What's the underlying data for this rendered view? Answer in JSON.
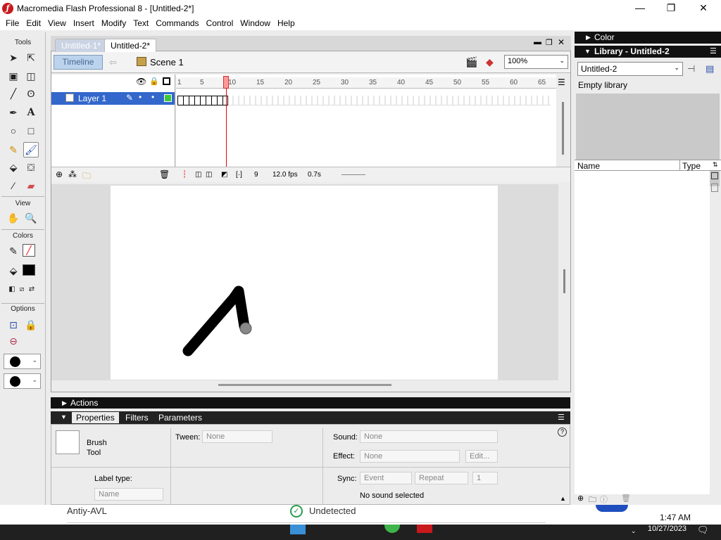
{
  "window": {
    "title": "Macromedia Flash Professional 8 - [Untitled-2*]",
    "minimize_glyph": "—",
    "maximize_glyph": "❐",
    "close_glyph": "✕"
  },
  "menu": [
    "File",
    "Edit",
    "View",
    "Insert",
    "Modify",
    "Text",
    "Commands",
    "Control",
    "Window",
    "Help"
  ],
  "tools": {
    "header": "Tools",
    "view_header": "View",
    "colors_header": "Colors",
    "options_header": "Options",
    "selected_tool": "brush-tool"
  },
  "document": {
    "tabs": [
      "Untitled-1*",
      "Untitled-2*"
    ],
    "active_tab": "Untitled-2*",
    "timeline_button": "Timeline",
    "scene": "Scene 1",
    "zoom": "100%"
  },
  "timeline": {
    "layer_name": "Layer 1",
    "ruler_ticks": [
      "1",
      "5",
      "10",
      "15",
      "20",
      "25",
      "30",
      "35",
      "40",
      "45",
      "50",
      "55",
      "60",
      "65"
    ],
    "current_frame": "9",
    "frame_rate": "12.0 fps",
    "elapsed": "0.7s"
  },
  "panels": {
    "actions": "Actions",
    "property_tabs": [
      "Properties",
      "Filters",
      "Parameters"
    ],
    "tool_name_line1": "Brush",
    "tool_name_line2": "Tool",
    "tween_label": "Tween:",
    "tween_value": "None",
    "sound_label": "Sound:",
    "sound_value": "None",
    "effect_label": "Effect:",
    "effect_value": "None",
    "edit_button": "Edit...",
    "label_type_label": "Label type:",
    "label_type_value": "Name",
    "sync_label": "Sync:",
    "sync_value": "Event",
    "repeat_value": "Repeat",
    "repeat_count": "1",
    "sound_status": "No sound selected"
  },
  "right": {
    "color_title": "Color",
    "library_title": "Library - Untitled-2",
    "library_select": "Untitled-2",
    "empty_text": "Empty library",
    "col_name": "Name",
    "col_type": "Type"
  },
  "taskbar": {
    "overlay_left": "Antiy-AVL",
    "overlay_status": "Undetected",
    "time": "1:47 AM",
    "date": "10/27/2023"
  },
  "colors": {
    "selection_blue": "#3367cc",
    "playhead_red": "#e00000",
    "stroke_black": "#000000"
  }
}
